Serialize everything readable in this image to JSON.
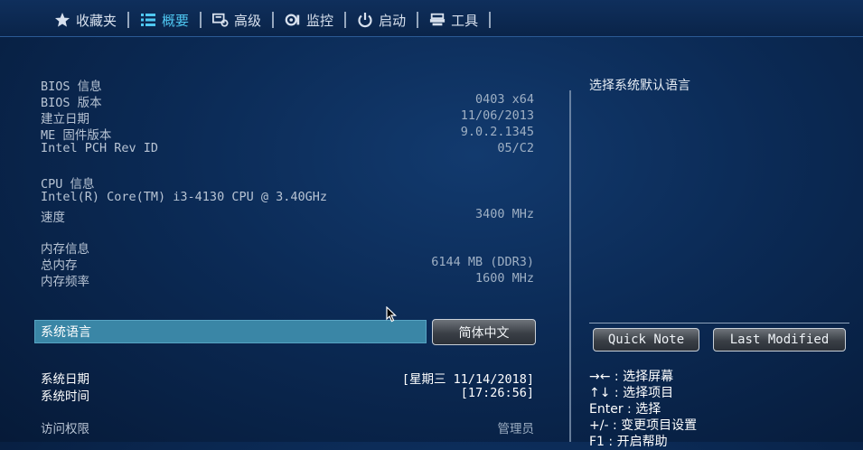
{
  "nav": {
    "tabs": [
      {
        "label": "收藏夹",
        "icon": "star-icon",
        "active": false
      },
      {
        "label": "概要",
        "icon": "list-icon",
        "active": true
      },
      {
        "label": "高级",
        "icon": "advanced-icon",
        "active": false
      },
      {
        "label": "监控",
        "icon": "monitor-fan-icon",
        "active": false
      },
      {
        "label": "启动",
        "icon": "power-icon",
        "active": false
      },
      {
        "label": "工具",
        "icon": "tool-icon",
        "active": false
      }
    ]
  },
  "bios": {
    "header": "BIOS 信息",
    "version_label": "BIOS 版本",
    "version": "0403 x64",
    "build_label": "建立日期",
    "build": "11/06/2013",
    "me_label": "ME 固件版本",
    "me": "9.0.2.1345",
    "pch_label": "Intel PCH Rev ID",
    "pch": "05/C2"
  },
  "cpu": {
    "header": "CPU 信息",
    "model": "Intel(R) Core(TM) i3-4130 CPU @ 3.40GHz",
    "speed_label": "速度",
    "speed": "3400 MHz"
  },
  "memory": {
    "header": "内存信息",
    "total_label": "总内存",
    "total": "6144 MB (DDR3)",
    "freq_label": "内存频率",
    "freq": "1600 MHz"
  },
  "language": {
    "label": "系统语言",
    "value": "简体中文"
  },
  "datetime": {
    "date_label": "系统日期",
    "date": "[星期三 11/14/2018]",
    "time_label": "系统时间",
    "time": "[17:26:56]"
  },
  "access": {
    "label": "访问权限",
    "value": "管理员"
  },
  "help": {
    "title": "选择系统默认语言",
    "quick_note": "Quick Note",
    "last_modified": "Last Modified",
    "keys": [
      "→← : 选择屏幕",
      "↑↓ : 选择项目",
      "Enter : 选择",
      "+/- : 变更项目设置",
      "F1 : 开启帮助"
    ]
  },
  "colors": {
    "accent": "#4fc8f2",
    "selection": "#3a86a6",
    "background": "#0b2a55"
  }
}
